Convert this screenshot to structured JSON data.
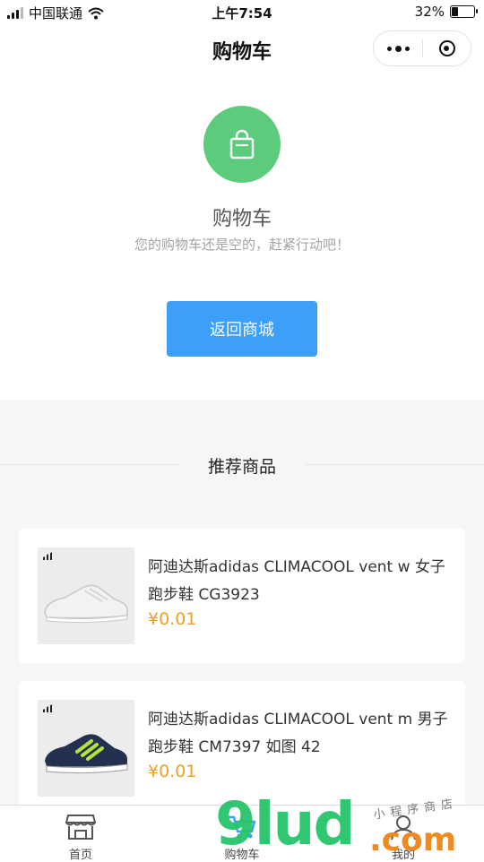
{
  "status_bar": {
    "carrier": "中国联通",
    "time": "上午7:54",
    "battery_text": "32%",
    "battery_level": 0.32
  },
  "nav": {
    "title": "购物车"
  },
  "empty_cart": {
    "icon": "shopping-bag-icon",
    "title": "购物车",
    "description": "您的购物车还是空的，赶紧行动吧！",
    "button_label": "返回商城"
  },
  "recommend": {
    "title": "推荐商品",
    "products": [
      {
        "name": "阿迪达斯adidas CLIMACOOL vent w 女子 跑步鞋 CG3923",
        "price": "¥0.01",
        "shoe_color": "#f2f2f2"
      },
      {
        "name": "阿迪达斯adidas CLIMACOOL vent m 男子 跑步鞋 CM7397 如图 42",
        "price": "¥0.01",
        "shoe_color": "#24304f"
      }
    ]
  },
  "tab_bar": {
    "items": [
      {
        "label": "首页",
        "icon": "store-icon"
      },
      {
        "label": "购物车",
        "icon": "cart-icon"
      },
      {
        "label": "我的",
        "icon": "user-icon"
      }
    ]
  },
  "watermark": {
    "brand": "9lud",
    "domain": ".com",
    "tagline": "小程序商店"
  },
  "colors": {
    "accent_green": "#5ccb7c",
    "button_blue": "#3d9ff8",
    "price_orange": "#f0a020",
    "section_gray": "#f6f6f6"
  }
}
